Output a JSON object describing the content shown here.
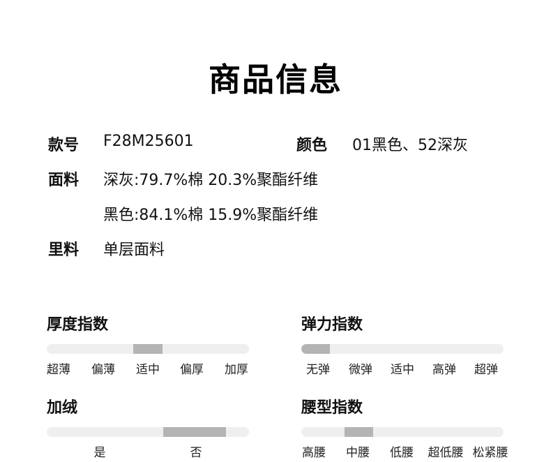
{
  "page_title": "商品信息",
  "specs": {
    "style_no_label": "款号",
    "style_no_value": "F28M25601",
    "color_label": "颜色",
    "color_value": "01黑色、52深灰",
    "fabric_label": "面料",
    "fabric_line1": "深灰:79.7%棉 20.3%聚酯纤维",
    "fabric_line2": "黑色:84.1%棉 15.9%聚酯纤维",
    "lining_label": "里料",
    "lining_value": "单层面料"
  },
  "gauges": {
    "thickness": {
      "title": "厚度指数",
      "options": [
        "超薄",
        "偏薄",
        "适中",
        "偏厚",
        "加厚"
      ],
      "selected": "适中"
    },
    "elasticity": {
      "title": "弹力指数",
      "options": [
        "无弹",
        "微弹",
        "适中",
        "高弹",
        "超弹"
      ],
      "selected": "无弹"
    },
    "fleece": {
      "title": "加绒",
      "options": [
        "是",
        "否"
      ],
      "selected": "否"
    },
    "waist": {
      "title": "腰型指数",
      "options": [
        "高腰",
        "中腰",
        "低腰",
        "超低腰",
        "松紧腰"
      ],
      "selected": "中腰"
    }
  },
  "colors": {
    "track": "#efefef",
    "fill": "#b4b4b4"
  }
}
